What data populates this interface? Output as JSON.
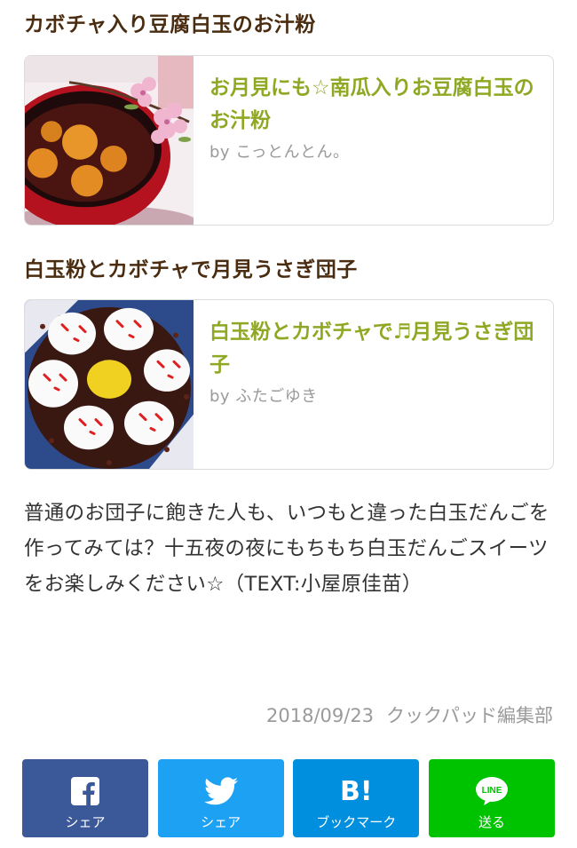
{
  "sections": [
    {
      "heading": "カボチャ入り豆腐白玉のお汁粉",
      "card": {
        "title": "お月見にも☆南瓜入りお豆腐白玉のお汁粉",
        "author": "by こっとんとん。"
      }
    },
    {
      "heading": "白玉粉とカボチャで月見うさぎ団子",
      "card": {
        "title": "白玉粉とカボチャで♬月見うさぎ団子",
        "author": "by ふたごゆき"
      }
    }
  ],
  "description": "普通のお団子に飽きた人も、いつもと違った白玉だんごを作ってみては？十五夜の夜にもちもち白玉だんごスイーツをお楽しみください☆（TEXT:小屋原佳苗）",
  "meta": {
    "date": "2018/09/23",
    "editor": "クックパッド編集部"
  },
  "share": [
    {
      "icon": "facebook-icon",
      "label": "シェア",
      "color": "#3b5998"
    },
    {
      "icon": "twitter-icon",
      "label": "シェア",
      "color": "#1da1f2"
    },
    {
      "icon": "hatena-bookmark-icon",
      "glyph": "B!",
      "label": "ブックマーク",
      "color": "#008fde"
    },
    {
      "icon": "line-icon",
      "glyph": "LINE",
      "label": "送る",
      "color": "#00c300"
    }
  ],
  "colors": {
    "heading": "#4a2c10",
    "card_title": "#8fa823",
    "muted": "#9a9a9a"
  }
}
